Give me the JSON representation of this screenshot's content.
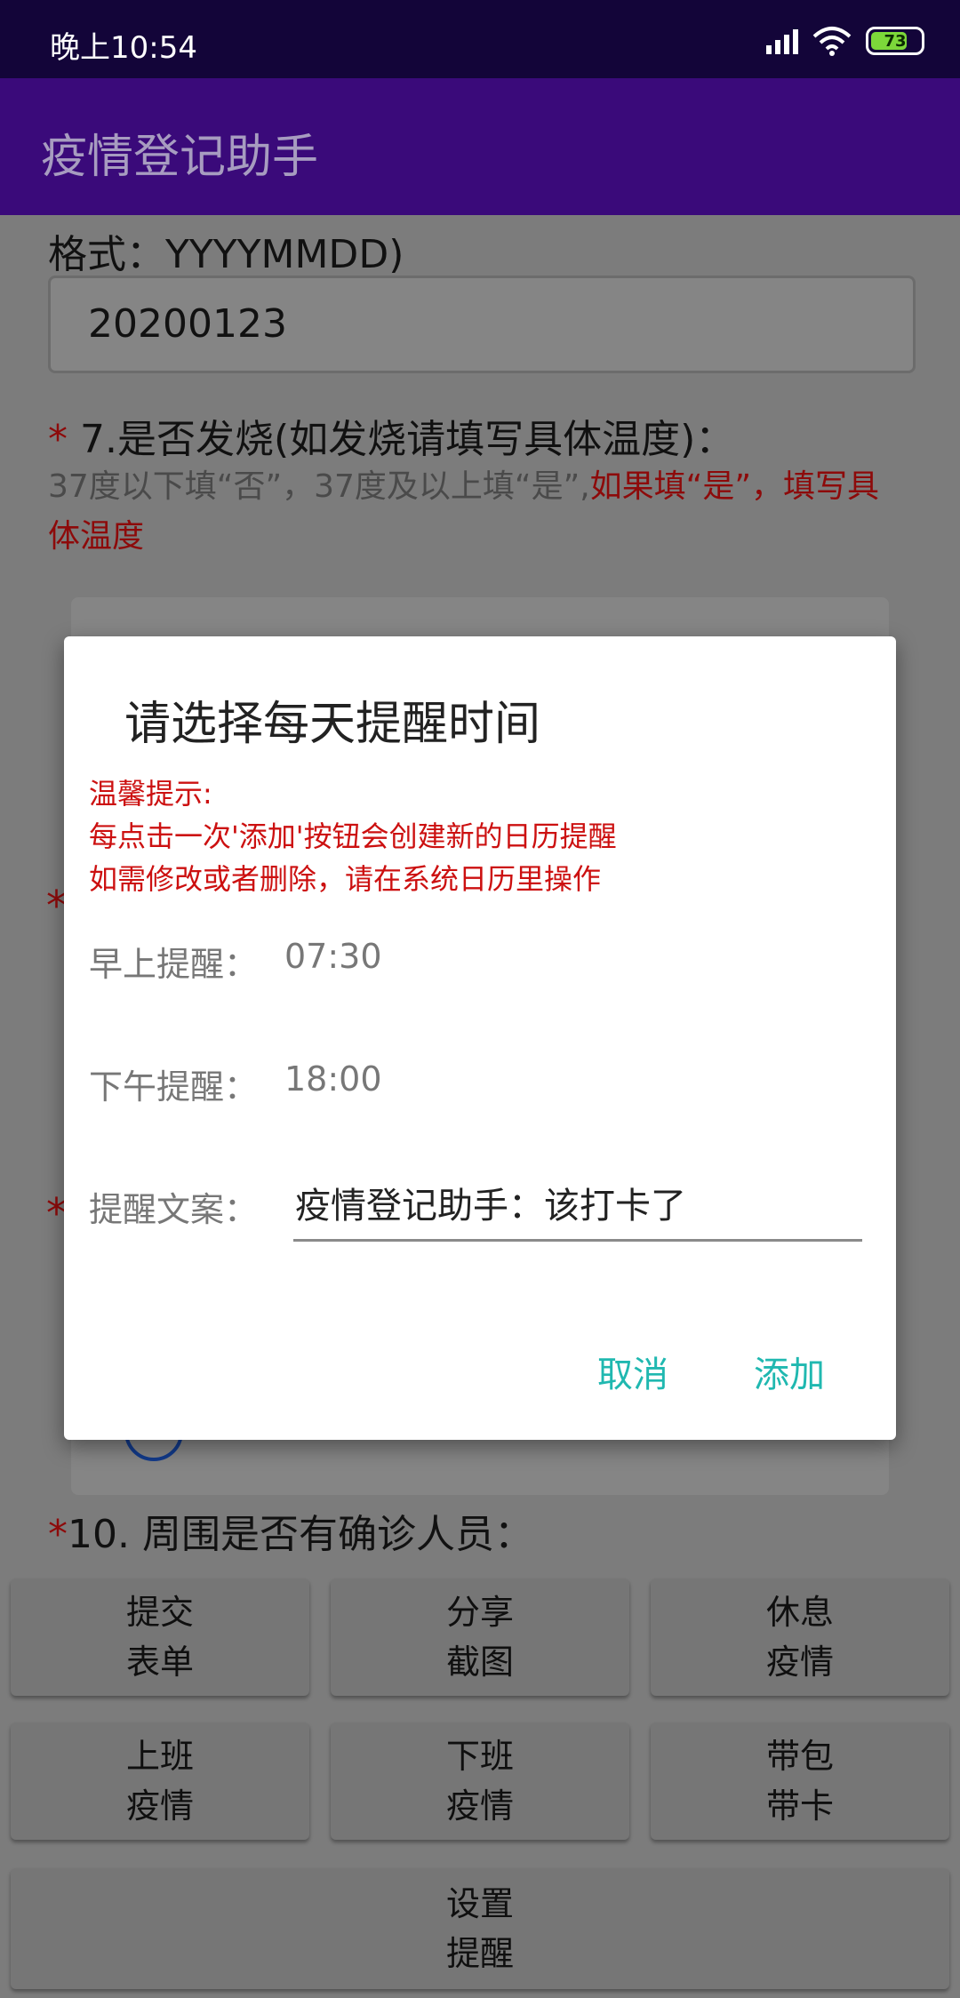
{
  "status_bar": {
    "time": "晚上10:54",
    "battery": "73",
    "icons": [
      "signal-icon",
      "wifi-icon",
      "battery-icon"
    ]
  },
  "app_bar": {
    "title": "疫情登记助手"
  },
  "form": {
    "date_format_hint": "格式：YYYYMMDD)",
    "date_value": "20200123",
    "q7_asterisk": "*",
    "q7_title": " 7.是否发烧(如发烧请填写具体温度)：",
    "q7_hint_grey": "37度以下填“否”，37度及以上填“是”,",
    "q7_hint_red_1": "如果填“是”，填写具",
    "q7_hint_red_2": "体温度",
    "side_asterisk": "*",
    "q10_asterisk": "*",
    "q10_title": "10. 周围是否有确诊人员："
  },
  "buttons": {
    "submit_line1": "提交",
    "submit_line2": "表单",
    "share_line1": "分享",
    "share_line2": "截图",
    "rest_line1": "休息",
    "rest_line2": "疫情",
    "work_line1": "上班",
    "work_line2": "疫情",
    "offwork_line1": "下班",
    "offwork_line2": "疫情",
    "bag_line1": "带包",
    "bag_line2": "带卡",
    "remind_line1": "设置",
    "remind_line2": "提醒"
  },
  "dialog": {
    "title": "请选择每天提醒时间",
    "tip_line1": "温馨提示:",
    "tip_line2": "每点击一次'添加'按钮会创建新的日历提醒",
    "tip_line3": "如需修改或者删除，请在系统日历里操作",
    "morning_label": "早上提醒：",
    "morning_time": "07:30",
    "afternoon_label": "下午提醒：",
    "afternoon_time": "18:00",
    "copy_label": "提醒文案：",
    "copy_value": "疫情登记助手：该打卡了",
    "cancel": "取消",
    "add": "添加"
  },
  "colors": {
    "accent": "#20b8b0",
    "tip_red": "#cc1010",
    "app_bar": "#3a0a7a",
    "status_bar": "#130539"
  }
}
